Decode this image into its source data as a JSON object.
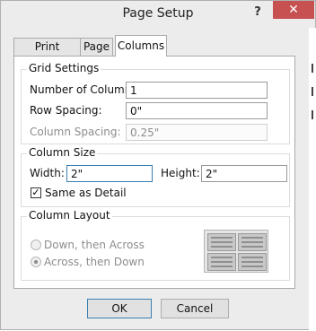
{
  "window": {
    "title": "Page Setup",
    "help_symbol": "?",
    "close_symbol": "✕"
  },
  "tabs": [
    {
      "label": "Print Options",
      "active": false
    },
    {
      "label": "Page",
      "active": false
    },
    {
      "label": "Columns",
      "active": true
    }
  ],
  "grid_settings": {
    "title": "Grid Settings",
    "number_of_columns": {
      "label": "Number of Columns:",
      "value": "1"
    },
    "row_spacing": {
      "label": "Row Spacing:",
      "value": "0\""
    },
    "column_spacing": {
      "label": "Column Spacing:",
      "value": "0.25\"",
      "disabled": true
    }
  },
  "column_size": {
    "title": "Column Size",
    "width": {
      "label": "Width:",
      "value": "2\""
    },
    "height": {
      "label": "Height:",
      "value": "2\""
    },
    "same_as_detail": {
      "label": "Same as Detail",
      "checked": true,
      "check_symbol": "✓"
    }
  },
  "column_layout": {
    "title": "Column Layout",
    "options": [
      {
        "label": "Down, then Across",
        "checked": false
      },
      {
        "label": "Across, then Down",
        "checked": true
      }
    ],
    "preview_icon": "column-layout-preview-icon"
  },
  "buttons": {
    "ok": "OK",
    "cancel": "Cancel"
  },
  "colors": {
    "close_button": "#c75050",
    "focus_border": "#3c7fb1",
    "dialog_bg": "#ececec"
  }
}
